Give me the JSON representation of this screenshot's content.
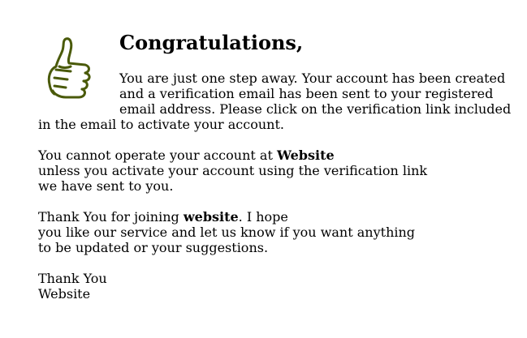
{
  "title": "Congratulations,",
  "intro": "You are just one step away. Your account has been created and a verification email has been sent to your registered email address. Please click on the verification link included in the email to activate your account.",
  "warning": {
    "prefix": "You cannot operate your account at ",
    "site": "Website",
    "line2": "unless you activate your account using the verification link",
    "line3": "we have sent to you."
  },
  "thanks": {
    "prefix": "Thank You for joining ",
    "site": "website",
    "suffix": ". I hope",
    "line2": "you like our service and let us know if you want anything",
    "line3": "to be updated or your suggestions."
  },
  "signature": {
    "line1": "Thank You",
    "line2": "Website"
  },
  "icon": "thumbs-up-icon",
  "colors": {
    "icon_stroke": "#4a5a0a",
    "text": "#000000"
  }
}
